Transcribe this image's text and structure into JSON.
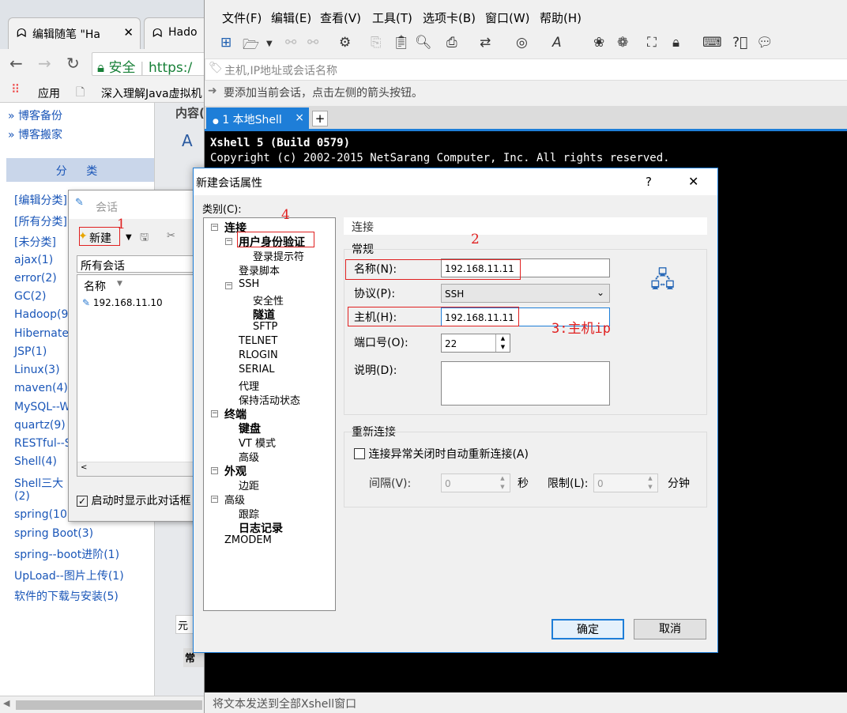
{
  "browser": {
    "tabs": [
      {
        "title": "编辑随笔 \"Ha"
      },
      {
        "title": "Hado"
      }
    ],
    "security_label": "安全",
    "url_prefix": "https:/",
    "bookmarks": [
      {
        "label": "应用"
      },
      {
        "label": "深入理解Java虚拟机"
      }
    ]
  },
  "blog": {
    "top_links": [
      "» 博客备份",
      "» 博客搬家"
    ],
    "category_header": "分 类",
    "categories": [
      "[编辑分类]",
      "[所有分类]",
      "[未分类]",
      "ajax(1)",
      "error(2)",
      "GC(2)",
      "Hadoop(9)",
      "Hibernate(",
      "JSP(1)",
      "Linux(3)",
      "maven(4)",
      "MySQL--W",
      "quartz(9)",
      "RESTful--S",
      "Shell(4)",
      "Shell三大",
      "(2)",
      "spring(10)",
      "spring Boot(3)",
      "spring--boot进阶(1)",
      "UpLoad--图片上传(1)",
      "软件的下载与安装(5)"
    ],
    "right_texts": [
      "内容(",
      "元",
      "常"
    ]
  },
  "session_dialog": {
    "title": "会话",
    "new_button": "新建",
    "folder": "所有会话",
    "col_name": "名称",
    "sessions": [
      "192.168.11.10"
    ],
    "startup_checkbox": "启动时显示此对话框"
  },
  "xshell": {
    "menu": [
      "文件(F)",
      "编辑(E)",
      "查看(V)",
      "工具(T)",
      "选项卡(B)",
      "窗口(W)",
      "帮助(H)"
    ],
    "address_placeholder": "主机,IP地址或会话名称",
    "hint": "要添加当前会话，点击左侧的箭头按钮。",
    "tab_label": "1 本地Shell",
    "tab_close": "×",
    "terminal_lines": [
      "Xshell 5 (Build 0579)",
      "Copyright (c) 2002-2015 NetSarang Computer, Inc. All rights reserved."
    ],
    "status": "将文本发送到全部Xshell窗口"
  },
  "dialog": {
    "title": "新建会话属性",
    "help": "?",
    "close": "✕",
    "category_label": "类别(C):",
    "tree": [
      {
        "label": "连接",
        "bold": true,
        "level": 0,
        "toggle": "−"
      },
      {
        "label": "用户身份验证",
        "bold": true,
        "level": 1,
        "toggle": "−"
      },
      {
        "label": "登录提示符",
        "bold": false,
        "level": 2
      },
      {
        "label": "登录脚本",
        "bold": false,
        "level": 1
      },
      {
        "label": "SSH",
        "bold": false,
        "level": 1,
        "toggle": "−"
      },
      {
        "label": "安全性",
        "bold": false,
        "level": 2
      },
      {
        "label": "隧道",
        "bold": true,
        "level": 2
      },
      {
        "label": "SFTP",
        "bold": false,
        "level": 2
      },
      {
        "label": "TELNET",
        "bold": false,
        "level": 1
      },
      {
        "label": "RLOGIN",
        "bold": false,
        "level": 1
      },
      {
        "label": "SERIAL",
        "bold": false,
        "level": 1
      },
      {
        "label": "代理",
        "bold": false,
        "level": 1
      },
      {
        "label": "保持活动状态",
        "bold": false,
        "level": 1
      },
      {
        "label": "终端",
        "bold": true,
        "level": 0,
        "toggle": "−"
      },
      {
        "label": "键盘",
        "bold": true,
        "level": 1
      },
      {
        "label": "VT 模式",
        "bold": false,
        "level": 1
      },
      {
        "label": "高级",
        "bold": false,
        "level": 1
      },
      {
        "label": "外观",
        "bold": true,
        "level": 0,
        "toggle": "−"
      },
      {
        "label": "边距",
        "bold": false,
        "level": 1
      },
      {
        "label": "高级",
        "bold": false,
        "level": 0,
        "toggle": "−"
      },
      {
        "label": "跟踪",
        "bold": false,
        "level": 1
      },
      {
        "label": "日志记录",
        "bold": true,
        "level": 1
      },
      {
        "label": "ZMODEM",
        "bold": false,
        "level": 0
      }
    ],
    "section_title": "连接",
    "general_label": "常规",
    "name_label": "名称(N):",
    "name_value": "192.168.11.11",
    "protocol_label": "协议(P):",
    "protocol_value": "SSH",
    "host_label": "主机(H):",
    "host_value": "192.168.11.11",
    "port_label": "端口号(O):",
    "port_value": "22",
    "desc_label": "说明(D):",
    "reconnect_group": "重新连接",
    "reconnect_checkbox": "连接异常关闭时自动重新连接(A)",
    "interval_label": "间隔(V):",
    "interval_value": "0",
    "interval_unit": "秒",
    "limit_label": "限制(L):",
    "limit_value": "0",
    "limit_unit": "分钟",
    "ok_button": "确定",
    "cancel_button": "取消"
  },
  "annotations": [
    "1",
    "2",
    "3:主机ip",
    "4"
  ]
}
